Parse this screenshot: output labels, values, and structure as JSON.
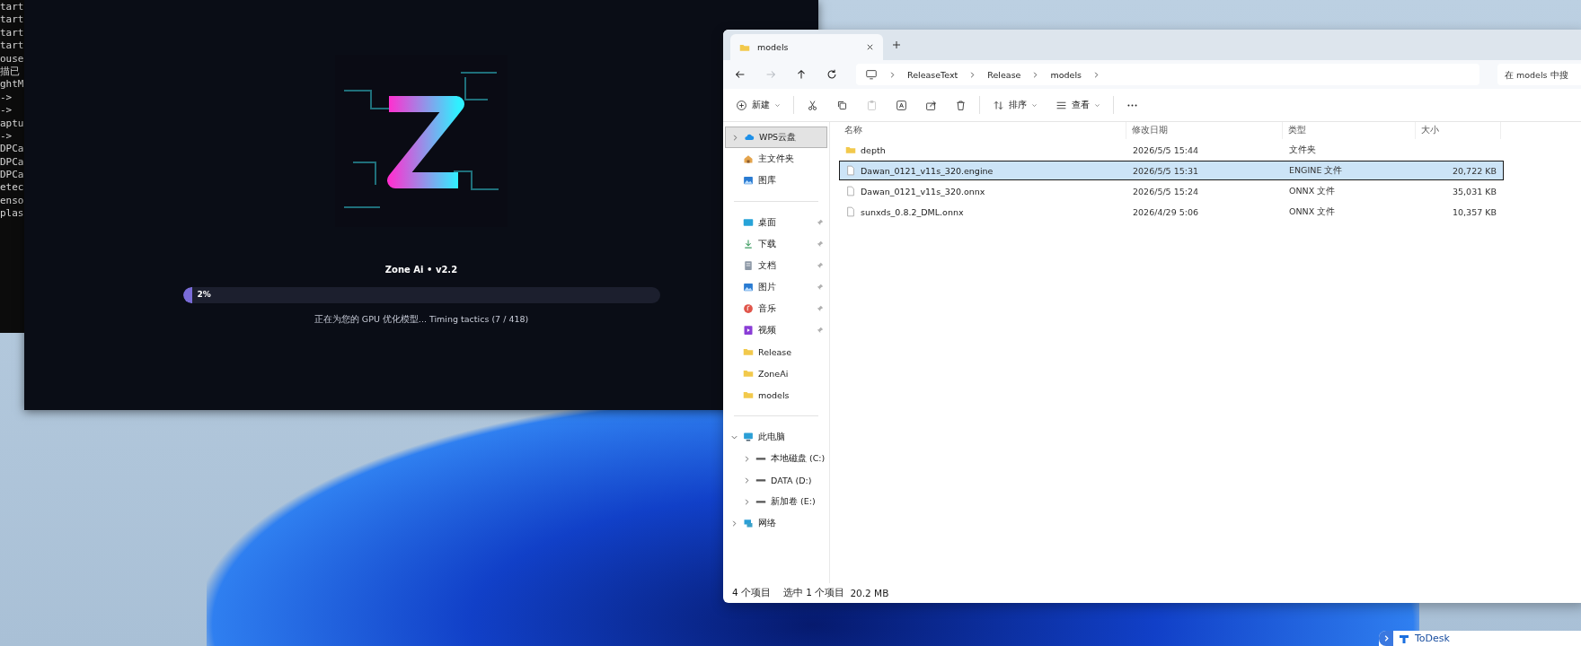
{
  "console": {
    "lines": [
      "tart",
      "tart",
      "tart",
      "tart",
      "ouse",
      "描已",
      "ghtM",
      "->",
      "->",
      "aptu",
      "->",
      "DPCa",
      "DPCa",
      "DPCa",
      "etec",
      "enso",
      "plas"
    ]
  },
  "splash": {
    "title": "Zone Ai • v2.2",
    "progress": {
      "level": 0.02,
      "label": "2%"
    },
    "status": "正在为您的 GPU 优化模型... Timing tactics (7 / 418)"
  },
  "explorer": {
    "tabs": [
      {
        "label": "models",
        "selected": true
      }
    ],
    "nav": [
      {
        "kind": "back",
        "disabled": false
      },
      {
        "kind": "forward",
        "disabled": true
      },
      {
        "kind": "up",
        "disabled": false
      },
      {
        "kind": "refresh",
        "disabled": false
      }
    ],
    "breadcrumb": [
      "ReleaseText",
      "Release",
      "models"
    ],
    "search": {
      "placeholder": "在 models 中搜"
    },
    "toolbar": [
      {
        "kind": "new",
        "label": "新建",
        "disabled": false
      },
      {
        "kind": "cut",
        "disabled": false
      },
      {
        "kind": "copy",
        "disabled": false
      },
      {
        "kind": "paste",
        "disabled": true
      },
      {
        "kind": "rename",
        "disabled": false
      },
      {
        "kind": "share",
        "disabled": false
      },
      {
        "kind": "delete",
        "disabled": false
      },
      {
        "kind": "sort",
        "label": "排序",
        "disabled": false
      },
      {
        "kind": "view",
        "label": "查看",
        "disabled": false
      },
      {
        "kind": "more",
        "disabled": false
      }
    ],
    "sidebar": [
      [
        {
          "label": "WPS云盘",
          "kind": "cloud",
          "selected": true,
          "expanded": false
        },
        {
          "label": "主文件夹",
          "kind": "home",
          "selected": false
        },
        {
          "label": "图库",
          "kind": "gallery",
          "selected": false
        }
      ],
      [
        {
          "label": "桌面",
          "kind": "desktop",
          "pinned": true,
          "selected": false
        },
        {
          "label": "下载",
          "kind": "download",
          "pinned": true,
          "selected": false
        },
        {
          "label": "文档",
          "kind": "document",
          "pinned": true,
          "selected": false
        },
        {
          "label": "图片",
          "kind": "picture",
          "pinned": true,
          "selected": false
        },
        {
          "label": "音乐",
          "kind": "music",
          "pinned": true,
          "selected": false
        },
        {
          "label": "视频",
          "kind": "video",
          "pinned": true,
          "selected": false
        },
        {
          "label": "Release",
          "kind": "folder",
          "pinned": false,
          "selected": false
        },
        {
          "label": "ZoneAi",
          "kind": "folder",
          "pinned": false,
          "selected": false
        },
        {
          "label": "models",
          "kind": "folder",
          "pinned": false,
          "selected": false
        }
      ],
      [
        {
          "label": "此电脑",
          "kind": "pc",
          "selected": false,
          "expanded": true,
          "children": [
            {
              "label": "本地磁盘 (C:)",
              "kind": "drive",
              "selected": false,
              "expanded": false
            },
            {
              "label": "DATA (D:)",
              "kind": "drive",
              "selected": false,
              "expanded": false
            },
            {
              "label": "新加卷 (E:)",
              "kind": "drive",
              "selected": false,
              "expanded": false
            }
          ]
        },
        {
          "label": "网络",
          "kind": "network",
          "selected": false,
          "expanded": false
        }
      ]
    ],
    "columns": [
      "名称",
      "修改日期",
      "类型",
      "大小"
    ],
    "rows": [
      {
        "kind": "folder",
        "name": "depth",
        "date": "2026/5/5 15:44",
        "type": "文件夹",
        "selected": false
      },
      {
        "kind": "file",
        "name": "Dawan_0121_v11s_320.engine",
        "date": "2026/5/5 15:31",
        "type": "ENGINE 文件",
        "size": "20,722 KB",
        "selected": true
      },
      {
        "kind": "file",
        "name": "Dawan_0121_v11s_320.onnx",
        "date": "2026/5/5 15:24",
        "type": "ONNX 文件",
        "size": "35,031 KB",
        "selected": false
      },
      {
        "kind": "file",
        "name": "sunxds_0.8.2_DML.onnx",
        "date": "2026/4/29 5:06",
        "type": "ONNX 文件",
        "size": "10,357 KB",
        "selected": false
      }
    ],
    "status": {
      "count": "4 个项目",
      "selection": "选中 1 个项目",
      "size": "20.2 MB"
    }
  },
  "todesk": {
    "label": "ToDesk"
  }
}
